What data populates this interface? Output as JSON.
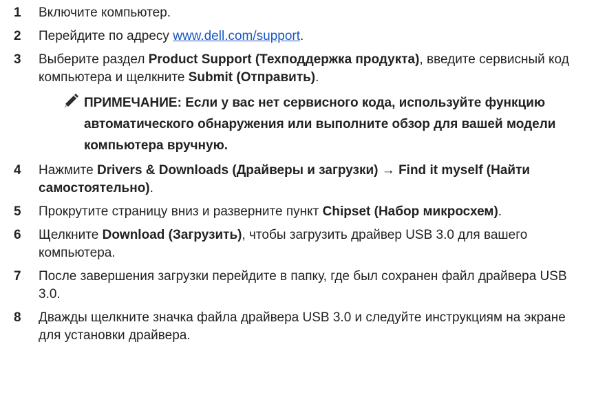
{
  "steps": [
    {
      "num": "1",
      "parts": [
        {
          "t": "Включите компьютер.",
          "s": "plain"
        }
      ]
    },
    {
      "num": "2",
      "parts": [
        {
          "t": "Перейдите по адресу ",
          "s": "plain"
        },
        {
          "t": "www.dell.com/support",
          "s": "link"
        },
        {
          "t": ".",
          "s": "plain"
        }
      ]
    },
    {
      "num": "3",
      "parts": [
        {
          "t": "Выберите раздел ",
          "s": "plain"
        },
        {
          "t": "Product Support (Техподдержка продукта)",
          "s": "bold"
        },
        {
          "t": ", введите сервисный код компьютера и щелкните ",
          "s": "plain"
        },
        {
          "t": "Submit (Отправить)",
          "s": "bold"
        },
        {
          "t": ".",
          "s": "plain"
        }
      ]
    },
    {
      "num": "4",
      "parts": [
        {
          "t": "Нажмите ",
          "s": "plain"
        },
        {
          "t": "Drivers & Downloads (Драйверы и загрузки)",
          "s": "bold"
        },
        {
          "t": " → ",
          "s": "plain"
        },
        {
          "t": "Find it myself (Найти самостоятельно)",
          "s": "bold"
        },
        {
          "t": ".",
          "s": "plain"
        }
      ]
    },
    {
      "num": "5",
      "parts": [
        {
          "t": "Прокрутите страницу вниз и разверните пункт ",
          "s": "plain"
        },
        {
          "t": "Chipset (Набор микросхем)",
          "s": "bold"
        },
        {
          "t": ".",
          "s": "plain"
        }
      ]
    },
    {
      "num": "6",
      "parts": [
        {
          "t": "Щелкните ",
          "s": "plain"
        },
        {
          "t": "Download (Загрузить)",
          "s": "bold"
        },
        {
          "t": ", чтобы загрузить драйвер USB 3.0 для вашего компьютера.",
          "s": "plain"
        }
      ]
    },
    {
      "num": "7",
      "parts": [
        {
          "t": "После завершения загрузки перейдите в папку, где был сохранен файл драйвера USB 3.0.",
          "s": "plain"
        }
      ]
    },
    {
      "num": "8",
      "parts": [
        {
          "t": "Дважды щелкните значка файла драйвера USB 3.0 и следуйте инструкциям на экране для установки драйвера.",
          "s": "plain"
        }
      ]
    }
  ],
  "note": {
    "icon": "note-pencil-icon",
    "text": "ПРИМЕЧАНИЕ: Если у вас нет сервисного кода, используйте функцию автоматического обнаружения или выполните обзор для вашей модели компьютера вручную."
  },
  "colors": {
    "text": "#222222",
    "link": "#1a57c4"
  }
}
